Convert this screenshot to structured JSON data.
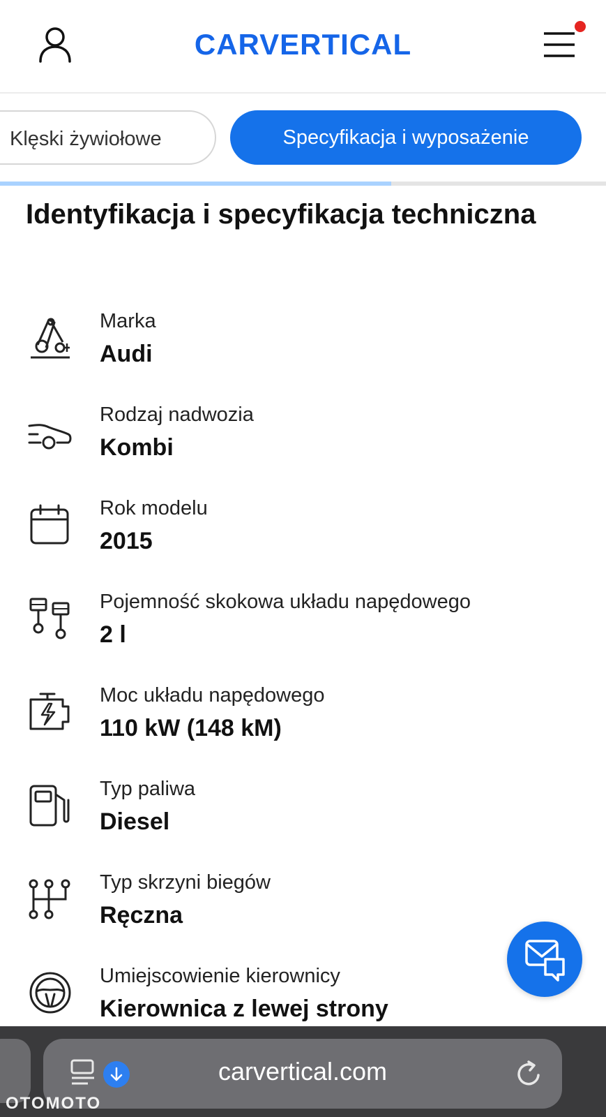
{
  "header": {
    "logo_text": "CARVERTICAL",
    "brand_color": "#1565e8",
    "notification_color": "#e52521"
  },
  "tabs": [
    {
      "label": "Klęski żywiołowe",
      "active": false
    },
    {
      "label": "Specyfikacja i wyposażenie",
      "active": true
    }
  ],
  "tab_progress": 0.645,
  "section": {
    "title": "Identyfikacja i specyfikacja techniczna"
  },
  "specs": [
    {
      "label": "Marka",
      "value": "Audi",
      "icon": "brand-icon"
    },
    {
      "label": "Rodzaj nadwozia",
      "value": "Kombi",
      "icon": "car-body-icon"
    },
    {
      "label": "Rok modelu",
      "value": "2015",
      "icon": "calendar-icon"
    },
    {
      "label": "Pojemność skokowa układu napędowego",
      "value": "2 l",
      "icon": "pistons-icon"
    },
    {
      "label": "Moc układu napędowego",
      "value": "110 kW (148 kM)",
      "icon": "engine-power-icon"
    },
    {
      "label": "Typ paliwa",
      "value": "Diesel",
      "icon": "fuel-pump-icon"
    },
    {
      "label": "Typ skrzyni biegów",
      "value": "Ręczna",
      "icon": "gearbox-icon"
    },
    {
      "label": "Umiejscowienie kierownicy",
      "value": "Kierownica z lewej strony",
      "icon": "steering-wheel-icon"
    }
  ],
  "browser": {
    "url": "carvertical.com"
  },
  "watermark": "OTOMOTO"
}
